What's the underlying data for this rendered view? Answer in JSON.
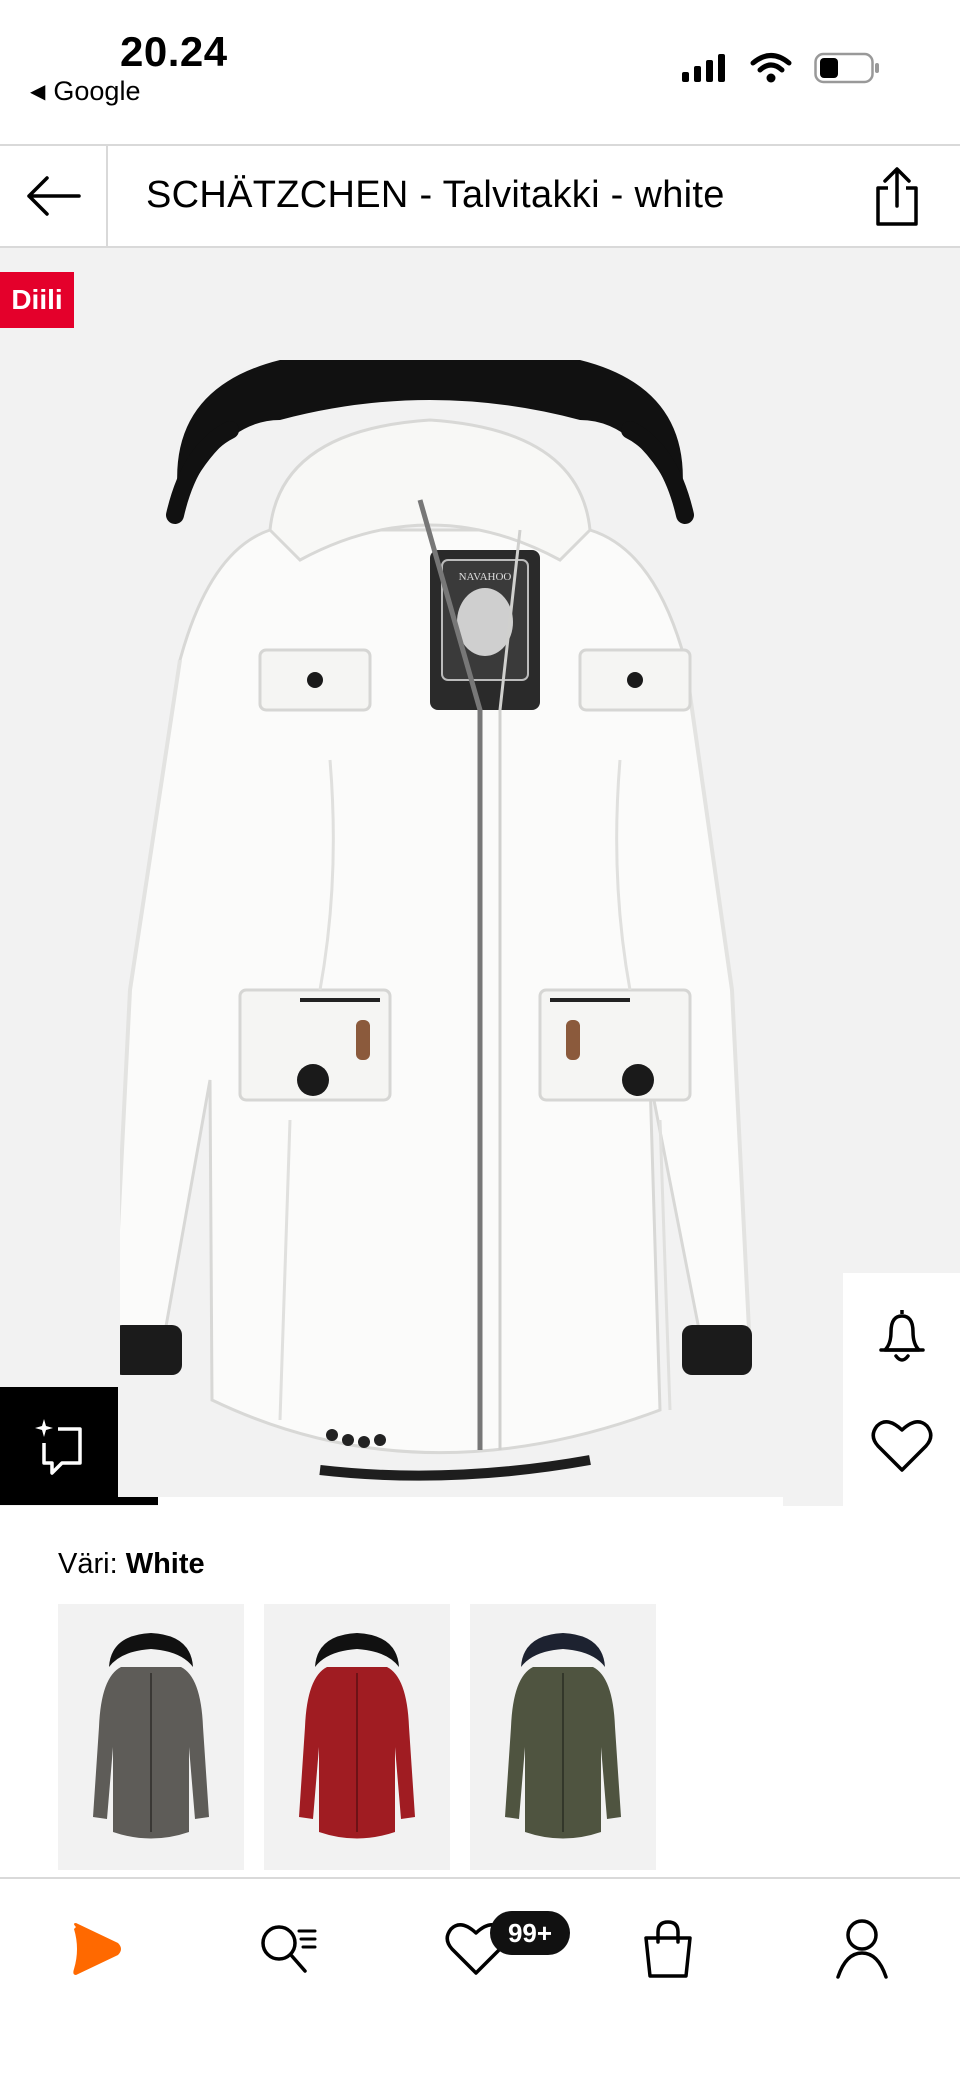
{
  "status_bar": {
    "time": "20.24",
    "back_app": "Google"
  },
  "header": {
    "title": "SCHÄTZCHEN - Talvitakki - white",
    "back_icon": "arrow-left-icon",
    "share_icon": "share-icon"
  },
  "product": {
    "deal_badge": "Diili",
    "image_brand_tag": "NAVAHOO",
    "jacket_color": "#ffffff",
    "fur_color": "#111111"
  },
  "side_actions": {
    "notify_icon": "bell-icon",
    "wishlist_icon": "heart-icon"
  },
  "similar": {
    "icon": "similar-items-icon"
  },
  "color": {
    "label": "Väri:",
    "selected": "White",
    "swatches": [
      {
        "name": "grey",
        "color": "#5e5c58"
      },
      {
        "name": "red",
        "color": "#a01c22"
      },
      {
        "name": "olive",
        "color": "#4f5440"
      }
    ]
  },
  "bottom_nav": {
    "items": [
      "home-icon",
      "search-icon",
      "wishlist-icon",
      "bag-icon",
      "profile-icon"
    ],
    "wishlist_badge": "99+"
  },
  "colors": {
    "accent": "#ff6900",
    "deal_red": "#e4002b"
  }
}
